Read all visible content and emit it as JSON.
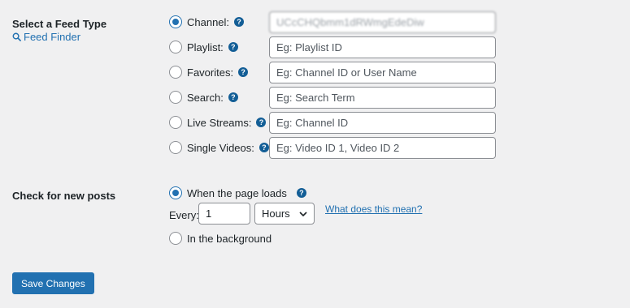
{
  "feed_type": {
    "title": "Select a Feed Type",
    "finder_link": "Feed Finder",
    "options": [
      {
        "label": "Channel:",
        "value": "UCcCHQbmm1dRWmgEdeDiw",
        "placeholder": ""
      },
      {
        "label": "Playlist:",
        "value": "",
        "placeholder": "Eg: Playlist ID"
      },
      {
        "label": "Favorites:",
        "value": "",
        "placeholder": "Eg: Channel ID or User Name"
      },
      {
        "label": "Search:",
        "value": "",
        "placeholder": "Eg: Search Term"
      },
      {
        "label": "Live Streams:",
        "value": "",
        "placeholder": "Eg: Channel ID"
      },
      {
        "label": "Single Videos:",
        "value": "",
        "placeholder": "Eg: Video ID 1, Video ID 2"
      }
    ],
    "selected_index": 0
  },
  "new_posts": {
    "title": "Check for new posts",
    "option_page_load": "When the page loads",
    "every_label": "Every:",
    "every_value": "1",
    "unit_selected": "Hours",
    "help_link": "What does this mean?",
    "option_background": "In the background",
    "selected": "page_load"
  },
  "save_button": "Save Changes",
  "help_symbol": "?",
  "colors": {
    "accent": "#2271b1",
    "help_icon": "#135e96",
    "background": "#f0f0f1"
  }
}
